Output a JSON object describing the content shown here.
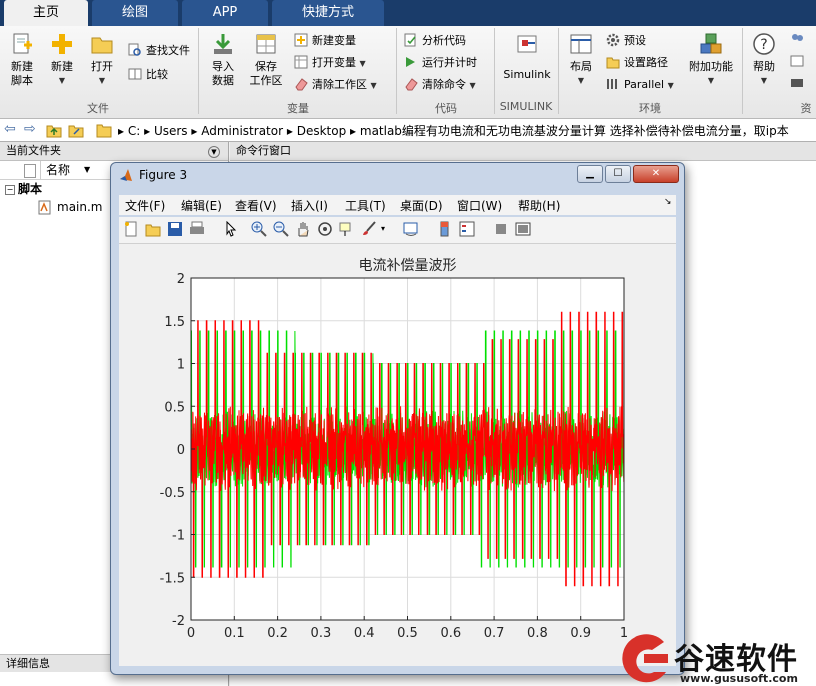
{
  "tabs": [
    {
      "label": "主页",
      "active": true
    },
    {
      "label": "绘图",
      "active": false
    },
    {
      "label": "APP",
      "active": false
    },
    {
      "label": "快捷方式",
      "active": false
    }
  ],
  "ribbon": {
    "file": {
      "group": "文件",
      "new_script": "新建\n脚本",
      "new_script_l1": "新建",
      "new_script_l2": "脚本",
      "new": "新建",
      "open": "打开",
      "find_files": "查找文件",
      "compare": "比较"
    },
    "variable": {
      "group": "变量",
      "import_l1": "导入",
      "import_l2": "数据",
      "save_l1": "保存",
      "save_l2": "工作区",
      "new_variable": "新建变量",
      "open_variable": "打开变量",
      "clear_workspace": "清除工作区"
    },
    "code": {
      "group": "代码",
      "analyze": "分析代码",
      "run_time": "运行并计时",
      "clear_commands": "清除命令"
    },
    "simulink": {
      "group": "SIMULINK",
      "label": "Simulink"
    },
    "environment": {
      "group": "环境",
      "layout": "布局",
      "preferences": "预设",
      "set_path": "设置路径",
      "parallel": "Parallel",
      "addons": "附加功能"
    },
    "resources": {
      "help": "帮助",
      "group": "资"
    }
  },
  "address": {
    "segments": [
      "C:",
      "Users",
      "Administrator",
      "Desktop",
      "matlab编程有功电流和无功电流基波分量计算  选择补偿待补偿电流分量，取ip本"
    ]
  },
  "left_panel": {
    "title": "当前文件夹",
    "column": "名称",
    "folder": "脚本",
    "file": "main.m",
    "details": "详细信息"
  },
  "command_window": {
    "title": "命令行窗口"
  },
  "figure": {
    "title": "Figure 3",
    "menus": [
      "文件(F)",
      "编辑(E)",
      "查看(V)",
      "插入(I)",
      "工具(T)",
      "桌面(D)",
      "窗口(W)",
      "帮助(H)"
    ]
  },
  "chart_data": {
    "type": "line",
    "title": "电流补偿量波形",
    "xlabel": "",
    "ylabel": "",
    "xlim": [
      0,
      1
    ],
    "ylim": [
      -2,
      2
    ],
    "xticks": [
      "0",
      "0.1",
      "0.2",
      "0.3",
      "0.4",
      "0.5",
      "0.6",
      "0.7",
      "0.8",
      "0.9",
      "1"
    ],
    "yticks": [
      "2",
      "1.5",
      "1",
      "0.5",
      "0",
      "-0.5",
      "-1",
      "-1.5",
      "-2"
    ],
    "grid": true,
    "series": [
      {
        "color": "#00e000",
        "envelope": [
          {
            "x0": 0.0,
            "x1": 0.24,
            "amp": 1.38
          },
          {
            "x0": 0.24,
            "x1": 0.42,
            "amp": 1.12
          },
          {
            "x0": 0.42,
            "x1": 0.67,
            "amp": 1.0
          },
          {
            "x0": 0.67,
            "x1": 1.0,
            "amp": 1.38
          }
        ],
        "cycles": 50,
        "baseline_noise": 0.2
      },
      {
        "color": "#ff0000",
        "envelope": [
          {
            "x0": 0.0,
            "x1": 0.17,
            "amp": 1.5
          },
          {
            "x0": 0.17,
            "x1": 0.42,
            "amp": 1.12
          },
          {
            "x0": 0.42,
            "x1": 0.68,
            "amp": 1.0
          },
          {
            "x0": 0.68,
            "x1": 0.85,
            "amp": 1.28
          },
          {
            "x0": 0.85,
            "x1": 1.0,
            "amp": 1.6
          }
        ],
        "cycles": 50,
        "baseline_noise": 0.25
      }
    ]
  },
  "watermark": {
    "brand": "谷速软件",
    "url": "www.gususoft.com"
  }
}
